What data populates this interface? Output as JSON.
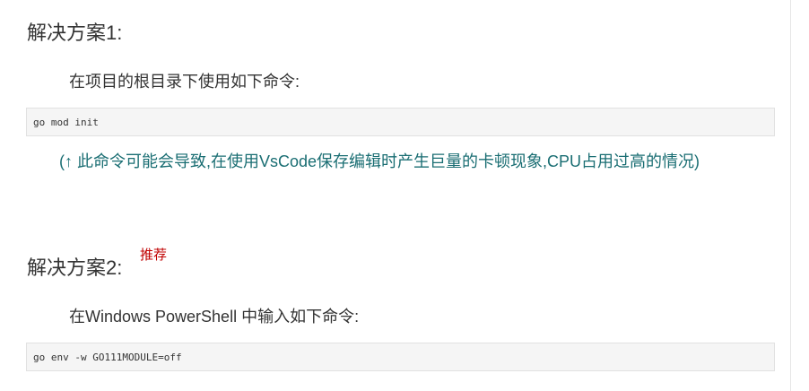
{
  "solution1": {
    "heading": "解决方案1:",
    "instruction": "在项目的根目录下使用如下命令:",
    "command": "go mod init",
    "note": "(↑ 此命令可能会导致,在使用VsCode保存编辑时产生巨量的卡顿现象,CPU占用过高的情况)"
  },
  "solution2": {
    "heading": "解决方案2:",
    "tag": "推荐",
    "instruction": "在Windows PowerShell 中输入如下命令:",
    "command": "go env -w GO111MODULE=off"
  },
  "colors": {
    "note": "#1a6e73",
    "tag": "#c00000",
    "code_bg": "#f5f5f5"
  }
}
